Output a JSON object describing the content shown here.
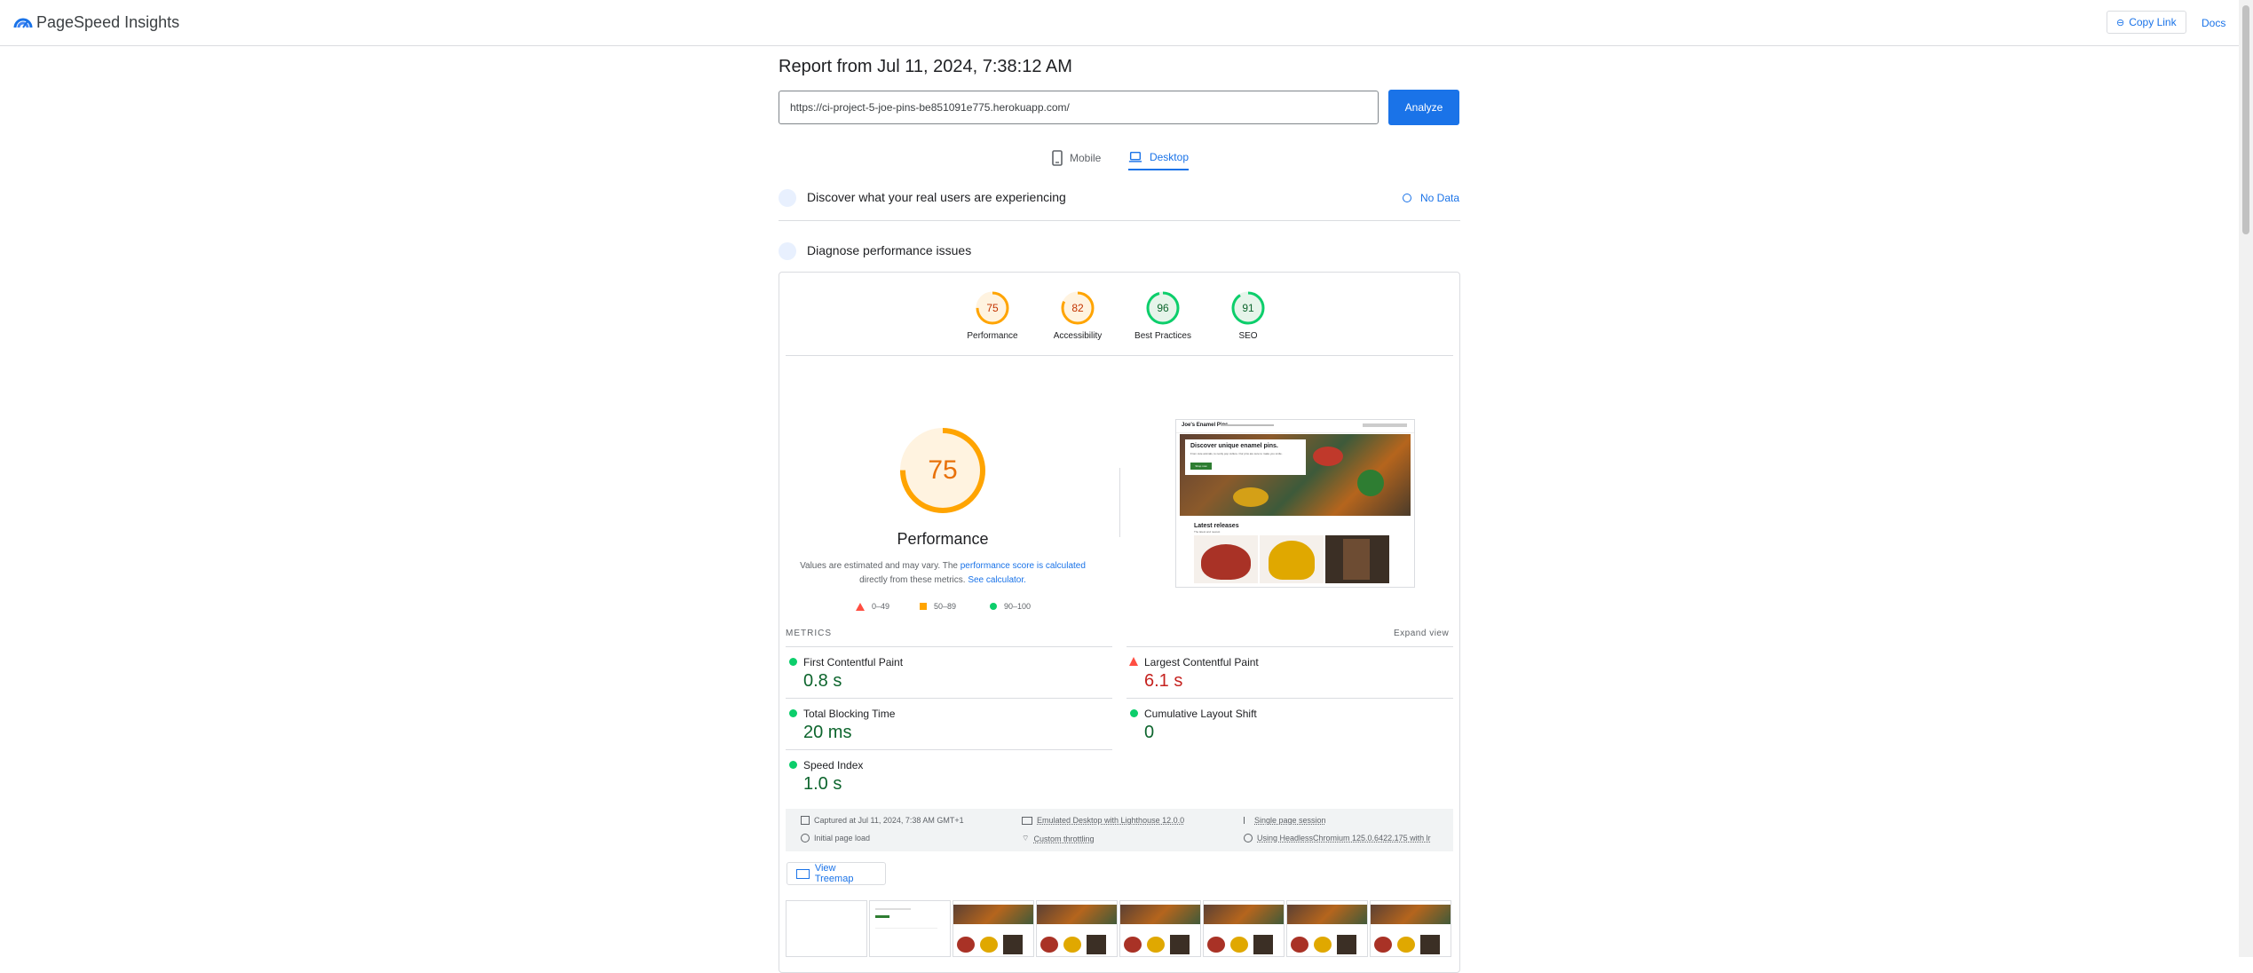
{
  "header": {
    "brand": "PageSpeed Insights",
    "copy_link": "Copy Link",
    "docs": "Docs"
  },
  "report": {
    "title": "Report from Jul 11, 2024, 7:38:12 AM",
    "url": "https://ci-project-5-joe-pins-be851091e775.herokuapp.com/",
    "analyze": "Analyze"
  },
  "tabs": {
    "mobile": "Mobile",
    "desktop": "Desktop",
    "active": "Desktop"
  },
  "field": {
    "title": "Discover what your real users are experiencing",
    "status": "No Data"
  },
  "lab": {
    "title": "Diagnose performance issues"
  },
  "colors": {
    "accent": "#1a73e8",
    "pass": "#0cce6b",
    "average": "#ffa400",
    "fail": "#ff4e42"
  },
  "scores": [
    {
      "label": "Performance",
      "value": "75",
      "score": 75,
      "rating": "average"
    },
    {
      "label": "Accessibility",
      "value": "82",
      "score": 82,
      "rating": "average"
    },
    {
      "label": "Best Practices",
      "value": "96",
      "score": 96,
      "rating": "pass"
    },
    {
      "label": "SEO",
      "value": "91",
      "score": 91,
      "rating": "pass"
    }
  ],
  "performance": {
    "score": "75",
    "title": "Performance",
    "note_start": "Values are estimated and may vary. The ",
    "note_link1": "performance score is calculated",
    "note_mid": "directly from these metrics. ",
    "note_link2": "See calculator."
  },
  "legend": {
    "fail": "0–49",
    "average": "50–89",
    "pass": "90–100"
  },
  "screenshot": {
    "site_name": "Joe's Enamel Pins",
    "hero_title": "Discover unique enamel pins.",
    "hero_sub": "From cute animals, to nerdy pop culture. Our pins are sure to make you smile.",
    "hero_btn": "Shop now",
    "latest": "Latest releases",
    "latest_sub": "The latest and newest"
  },
  "metrics": {
    "label": "METRICS",
    "expand": "Expand view",
    "items": [
      {
        "name": "First Contentful Paint",
        "value": "0.8 s",
        "rating": "pass"
      },
      {
        "name": "Largest Contentful Paint",
        "value": "6.1 s",
        "rating": "fail"
      },
      {
        "name": "Total Blocking Time",
        "value": "20 ms",
        "rating": "pass"
      },
      {
        "name": "Cumulative Layout Shift",
        "value": "0",
        "rating": "pass"
      },
      {
        "name": "Speed Index",
        "value": "1.0 s",
        "rating": "pass"
      }
    ]
  },
  "run_info": {
    "captured": "Captured at Jul 11, 2024, 7:38 AM GMT+1",
    "load": "Initial page load",
    "emulated": "Emulated Desktop with Lighthouse 12.0.0",
    "throttling": "Custom throttling",
    "session": "Single page session",
    "browser": "Using HeadlessChromium 125.0.6422.175 with lr"
  },
  "treemap": "View Treemap"
}
